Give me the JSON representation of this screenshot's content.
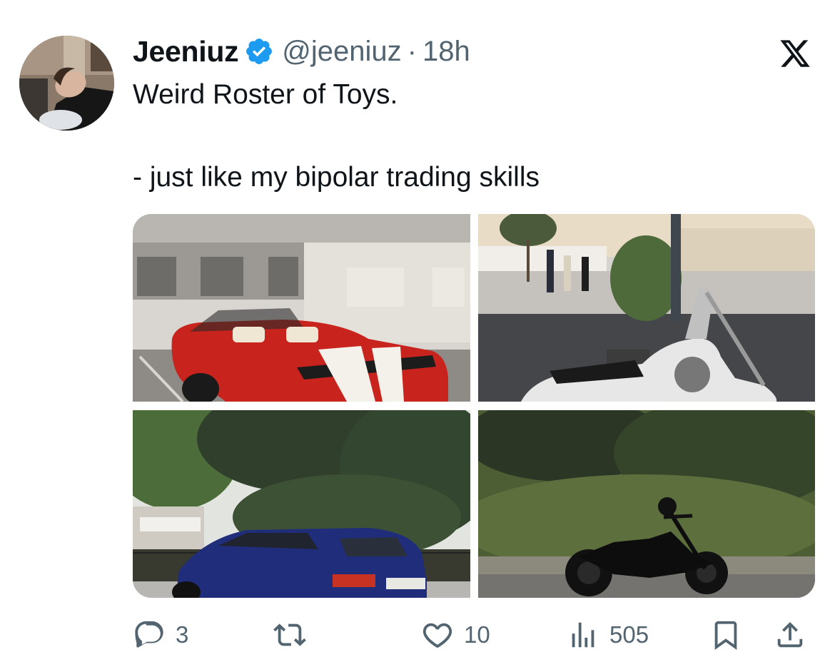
{
  "tweet": {
    "author_name": "Jeeniuz",
    "author_handle": "@jeeniuz",
    "separator": "·",
    "timestamp": "18h",
    "text_line1": "Weird Roster of Toys.",
    "text_line2": "- just like my bipolar trading skills",
    "verified": true
  },
  "media": [
    {
      "alt": "Red convertible car with white racing stripes in parking garage"
    },
    {
      "alt": "White motorcycle parked at a marina"
    },
    {
      "alt": "Blue SUV parked in front of trees"
    },
    {
      "alt": "Black motorcycle in front of overgrown wall"
    }
  ],
  "actions": {
    "reply_count": "3",
    "retweet_count": "",
    "like_count": "10",
    "views_count": "505"
  },
  "colors": {
    "text": "#0f1419",
    "secondary": "#536471",
    "verified_blue": "#1d9bf0"
  },
  "icons": [
    "x-logo-icon",
    "verified-badge-icon",
    "reply-icon",
    "retweet-icon",
    "like-icon",
    "views-icon",
    "bookmark-icon",
    "share-icon"
  ]
}
